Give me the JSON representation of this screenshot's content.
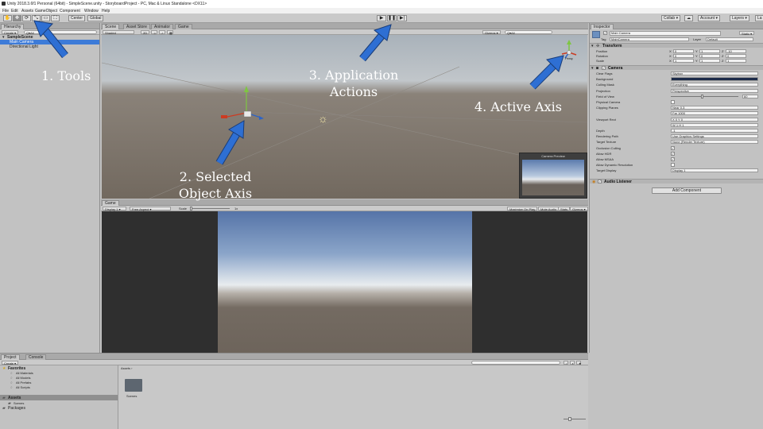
{
  "app": {
    "title": "Unity 2018.3.6f1 Personal (64bit) - SimpleScene.unity - StoryboardProject - PC, Mac & Linux Standalone <DX11>"
  },
  "menu": [
    "File",
    "Edit",
    "Assets",
    "GameObject",
    "Component",
    "Window",
    "Help"
  ],
  "toolbar": {
    "tools": [
      "✋",
      "✥",
      "⟳",
      "⤡",
      "▭",
      "⛶"
    ],
    "center_label": "Center",
    "pivot_label": "Global",
    "play_buttons": [
      "▶",
      "❚❚",
      "▶|"
    ],
    "collab_label": "Collab ▾",
    "cloud_icon": "cloud-icon",
    "account_label": "Account ▾",
    "layers_label": "Layers ▾",
    "layout_label": "La"
  },
  "hierarchy": {
    "tab": "Hierarchy",
    "create_label": "Create ▾",
    "search_placeholder": "Q▾All",
    "scene_name": "SampleScene",
    "items": [
      "Main Camera",
      "Directional Light"
    ]
  },
  "scene_view": {
    "tabs": [
      "Scene",
      "Asset Store",
      "Animator",
      "Game"
    ],
    "shading_label": "Shaded",
    "mode_2d": "2D",
    "gizmos_label": "Gizmos ▾",
    "search_placeholder": "Q▾All",
    "persp_label": "Persp",
    "camera_preview_title": "Camera Preview"
  },
  "game_view": {
    "tab": "Game",
    "display_label": "Display 1 ▾",
    "aspect_label": "Free Aspect ▾",
    "scale_label": "Scale",
    "scale_value": "1x",
    "options": [
      "Maximize On Play",
      "Mute Audio",
      "Stats",
      "Gizmos ▾"
    ]
  },
  "inspector": {
    "tab": "Inspector",
    "object_name": "Main Camera",
    "static_label": "Static ▾",
    "tag_label": "Tag",
    "tag_value": "MainCamera",
    "layer_label": "Layer",
    "layer_value": "Default",
    "transform_header": "Transform",
    "transform_rows": [
      {
        "label": "Position",
        "x": "0",
        "y": "1",
        "z": "-10"
      },
      {
        "label": "Rotation",
        "x": "0",
        "y": "0",
        "z": "0"
      },
      {
        "label": "Scale",
        "x": "1",
        "y": "1",
        "z": "1"
      }
    ],
    "camera_header": "Camera",
    "camera_rows": [
      {
        "label": "Clear Flags",
        "value": "Skybox"
      },
      {
        "label": "Background",
        "value": ""
      },
      {
        "label": "Culling Mask",
        "value": "Everything"
      },
      {
        "label": "Projection",
        "value": "Perspective"
      },
      {
        "label": "Field of View",
        "value": "60"
      },
      {
        "label": "Physical Camera",
        "value": ""
      },
      {
        "label": "Clipping Planes",
        "value": "Near 0.3"
      },
      {
        "label": "",
        "value": "Far 1000"
      },
      {
        "label": "Viewport Rect",
        "value": "X 0   Y 0"
      },
      {
        "label": "",
        "value": "W 1   H 1"
      },
      {
        "label": "Depth",
        "value": "-1"
      },
      {
        "label": "Rendering Path",
        "value": "Use Graphics Settings"
      },
      {
        "label": "Target Texture",
        "value": "None (Render Texture)"
      },
      {
        "label": "Occlusion Culling",
        "value": ""
      },
      {
        "label": "Allow HDR",
        "value": ""
      },
      {
        "label": "Allow MSAA",
        "value": ""
      },
      {
        "label": "Allow Dynamic Resolution",
        "value": ""
      },
      {
        "label": "Target Display",
        "value": "Display 1"
      }
    ],
    "audio_listener_header": "Audio Listener",
    "add_component_label": "Add Component"
  },
  "project": {
    "tabs": [
      "Project",
      "Console"
    ],
    "create_label": "Create ▾",
    "favorites_label": "Favorites",
    "favorites_items": [
      "All Materials",
      "All Models",
      "All Prefabs",
      "All Scripts"
    ],
    "assets_label": "Assets",
    "assets_children": [
      "Scenes"
    ],
    "packages_label": "Packages",
    "breadcrumb": "Assets ›",
    "folders": [
      "Scenes"
    ]
  },
  "annotations": [
    {
      "id": "tools",
      "text": "1. Tools"
    },
    {
      "id": "selected_axis",
      "line1": "2. Selected",
      "line2": "Object Axis"
    },
    {
      "id": "application_actions",
      "line1": "3. Application",
      "line2": "Actions"
    },
    {
      "id": "active_axis",
      "text": "4. Active Axis"
    }
  ],
  "colors": {
    "arrow_blue": "#2e6fd3",
    "selection_blue": "#3d7bd8",
    "scene_ground": "#72695f"
  }
}
